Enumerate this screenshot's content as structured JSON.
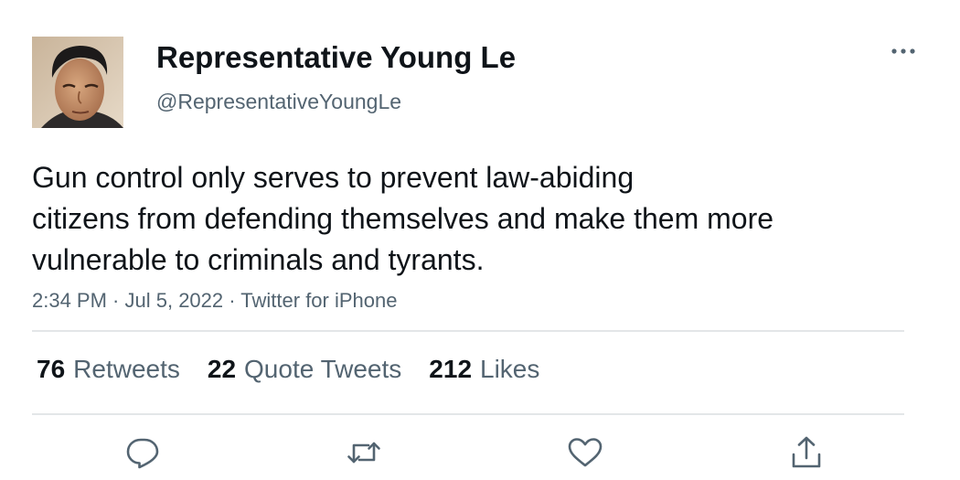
{
  "tweet": {
    "author": {
      "display_name": "Representative Young Le",
      "handle": "@RepresentativeYoungLe"
    },
    "text_lines": [
      "Gun control only serves to prevent law-abiding",
      "citizens from defending themselves and make them more",
      "vulnerable to criminals and tyrants."
    ],
    "time": "2:34 PM",
    "separator": " · ",
    "date": "Jul 5, 2022",
    "source": "Twitter for iPhone",
    "stats": {
      "retweets": {
        "count": "76",
        "label": "Retweets"
      },
      "quotes": {
        "count": "22",
        "label": "Quote Tweets"
      },
      "likes": {
        "count": "212",
        "label": "Likes"
      }
    }
  },
  "icons": {
    "more": "more-horizontal-icon",
    "reply": "reply-icon",
    "retweet": "retweet-icon",
    "like": "heart-icon",
    "share": "share-icon"
  },
  "colors": {
    "text": "#0f1419",
    "secondary": "#536471",
    "divider": "#e3e6e8",
    "icon": "#536471"
  }
}
